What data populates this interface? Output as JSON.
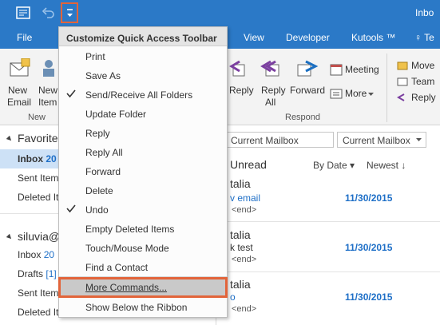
{
  "titlebar": {
    "title": "Inbo"
  },
  "tabs": [
    "File",
    "View",
    "Developer",
    "Kutools ™",
    "♀ Te"
  ],
  "ribbon": {
    "new_email": [
      "New",
      "Email"
    ],
    "new_items": [
      "New",
      "Item"
    ],
    "new_group_label": "New",
    "reply": "Reply",
    "reply_all": [
      "Reply",
      "All"
    ],
    "forward": "Forward",
    "meeting": "Meeting",
    "more": "More",
    "respond_group_label": "Respond",
    "quick_steps": [
      "Move",
      "Team",
      "Reply"
    ]
  },
  "folder_pane": {
    "favorites": "Favorite",
    "inbox": "Inbox",
    "inbox_count": "20",
    "sent": "Sent Items",
    "deleted": "Deleted It",
    "account": "siluvia@",
    "acc_inbox": "Inbox",
    "acc_inbox_count": "20",
    "drafts": "Drafts",
    "drafts_count": "[1]",
    "acc_sent": "Sent Item",
    "acc_deleted": "Deleted It"
  },
  "mail_list": {
    "search_scope": "Current Mailbox",
    "scope_dropdown": "Current Mailbox",
    "filter_unread": "Unread",
    "sort_by": "By Date",
    "sort_order": "Newest",
    "items": [
      {
        "sender": "talia",
        "subject": "v email",
        "preview": "<end>",
        "date": "11/30/2015"
      },
      {
        "sender": "talia",
        "subject": "k test",
        "preview": "<end>",
        "date": "11/30/2015"
      },
      {
        "sender": "talia",
        "subject": "o",
        "preview": "<end>",
        "date": "11/30/2015"
      }
    ]
  },
  "menu": {
    "header": "Customize Quick Access Toolbar",
    "items": [
      {
        "label": "Print",
        "checked": false
      },
      {
        "label": "Save As",
        "checked": false
      },
      {
        "label": "Send/Receive All Folders",
        "checked": true
      },
      {
        "label": "Update Folder",
        "checked": false
      },
      {
        "label": "Reply",
        "checked": false
      },
      {
        "label": "Reply All",
        "checked": false
      },
      {
        "label": "Forward",
        "checked": false
      },
      {
        "label": "Delete",
        "checked": false
      },
      {
        "label": "Undo",
        "checked": true
      },
      {
        "label": "Empty Deleted Items",
        "checked": false
      },
      {
        "label": "Touch/Mouse Mode",
        "checked": false
      },
      {
        "label": "Find a Contact",
        "checked": false
      }
    ],
    "more_commands": "More Commands...",
    "show_below": "Show Below the Ribbon"
  },
  "colors": {
    "accent": "#2b79c7",
    "highlight": "#e2643a",
    "date_blue": "#1e6fc7"
  }
}
